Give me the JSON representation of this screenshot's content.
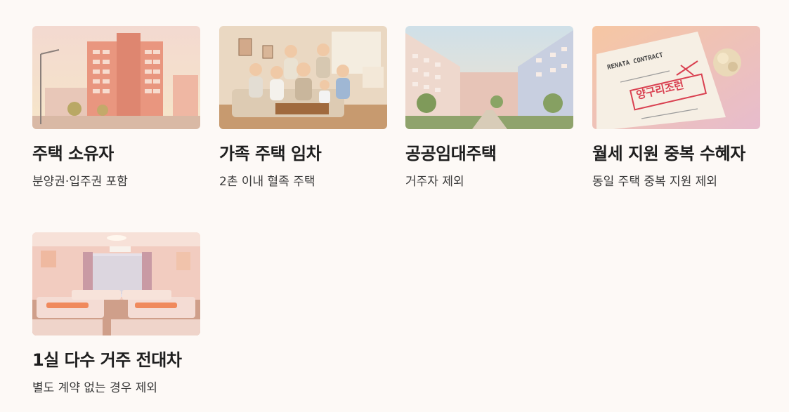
{
  "cards": [
    {
      "title": "주택 소유자",
      "desc": "분양권·입주권 포함",
      "image": "apartment-building-image"
    },
    {
      "title": "가족 주택 임차",
      "desc": "2촌 이내 혈족 주택",
      "image": "family-living-room-image"
    },
    {
      "title": "공공임대주택",
      "desc": "거주자 제외",
      "image": "public-housing-complex-image"
    },
    {
      "title": "월세 지원 중복 수혜자",
      "desc": "동일 주택 중복 지원 제외",
      "image": "rental-contract-rejected-image",
      "contract_heading": "RENATA CONTRACT",
      "stamp_text": "양구리조런"
    },
    {
      "title": "1실 다수 거주 전대차",
      "desc": "별도 계약 없는 경우 제외",
      "image": "shared-bedroom-image"
    }
  ]
}
